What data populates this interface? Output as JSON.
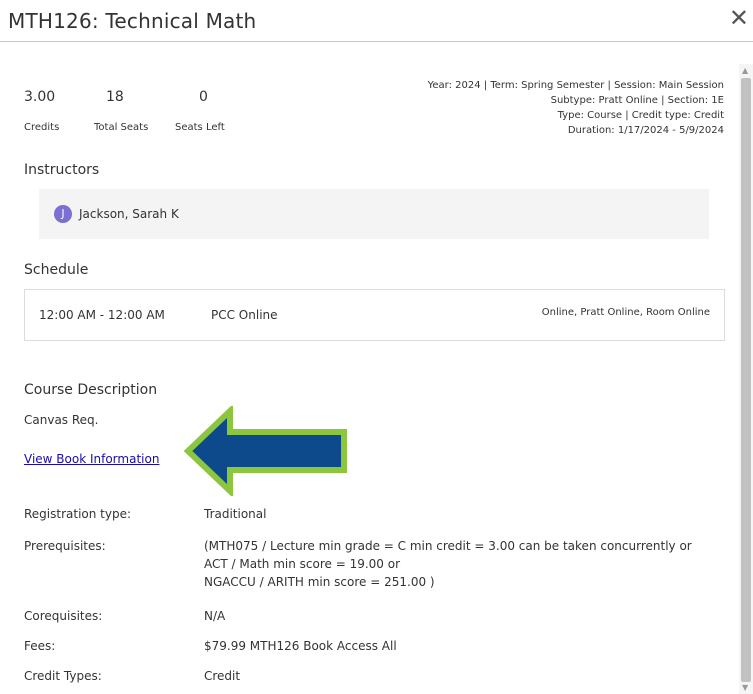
{
  "header": {
    "title": "MTH126: Technical Math",
    "close_glyph": "✕"
  },
  "stats": {
    "credits": {
      "value": "3.00",
      "label": "Credits"
    },
    "total_seats": {
      "value": "18",
      "label": "Total Seats"
    },
    "seats_left": {
      "value": "0",
      "label": "Seats Left"
    }
  },
  "meta": {
    "line1": "Year: 2024 | Term: Spring Semester | Session: Main Session",
    "line2": "Subtype: Pratt Online | Section: 1E",
    "line3": "Type: Course | Credit type: Credit",
    "line4": "Duration: 1/17/2024 - 5/9/2024"
  },
  "instructors": {
    "heading": "Instructors",
    "initial": "J",
    "name": "Jackson, Sarah K"
  },
  "schedule": {
    "heading": "Schedule",
    "time": "12:00 AM - 12:00 AM",
    "place": "PCC Online",
    "room": "Online, Pratt Online, Room Online"
  },
  "description": {
    "heading": "Course Description",
    "text": "Canvas Req.",
    "book_link": "View Book Information"
  },
  "details": {
    "registration_type": {
      "label": "Registration type:",
      "value": "Traditional"
    },
    "prerequisites": {
      "label": "Prerequisites:",
      "line1": "(MTH075 / Lecture min grade = C min credit = 3.00 can be taken concurrently or",
      "line2": "ACT / Math min score = 19.00 or",
      "line3": "NGACCU / ARITH min score = 251.00 )"
    },
    "corequisites": {
      "label": "Corequisites:",
      "value": "N/A"
    },
    "fees": {
      "label": "Fees:",
      "value": "$79.99 MTH126 Book Access All"
    },
    "credit_types": {
      "label": "Credit Types:",
      "value": "Credit"
    }
  },
  "colors": {
    "arrow_fill": "#0d4a8c",
    "arrow_outline": "#8cc63f",
    "avatar": "#7b6fd1",
    "link": "#1a0dab"
  }
}
